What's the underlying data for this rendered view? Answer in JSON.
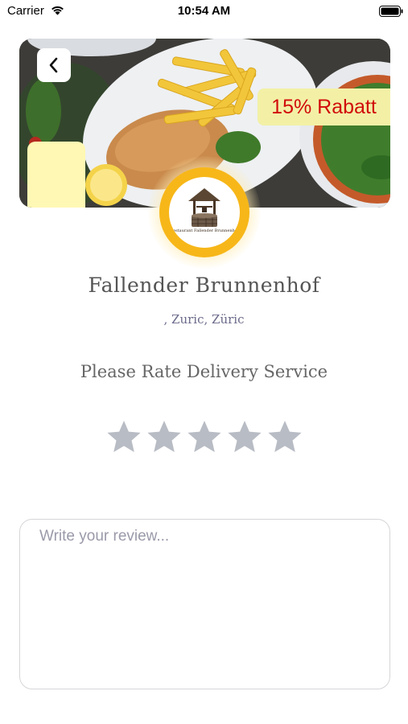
{
  "status_bar": {
    "carrier": "Carrier",
    "time": "10:54 AM"
  },
  "hero": {
    "discount_label": "15% Rabatt",
    "badge_background": "#f3f0a6",
    "badge_text_color": "#d10b0b"
  },
  "restaurant": {
    "name": "Fallender Brunnenhof",
    "address": ", Zuric, Züric",
    "logo_caption": "Restaurant Fallender Brunnenhof",
    "logo_ring_color": "#f7b719"
  },
  "rating": {
    "prompt": "Please Rate Delivery Service",
    "max_stars": 5,
    "selected_stars": 0,
    "star_color": "#b8bcc4"
  },
  "review": {
    "placeholder": "Write your review...",
    "value": ""
  }
}
